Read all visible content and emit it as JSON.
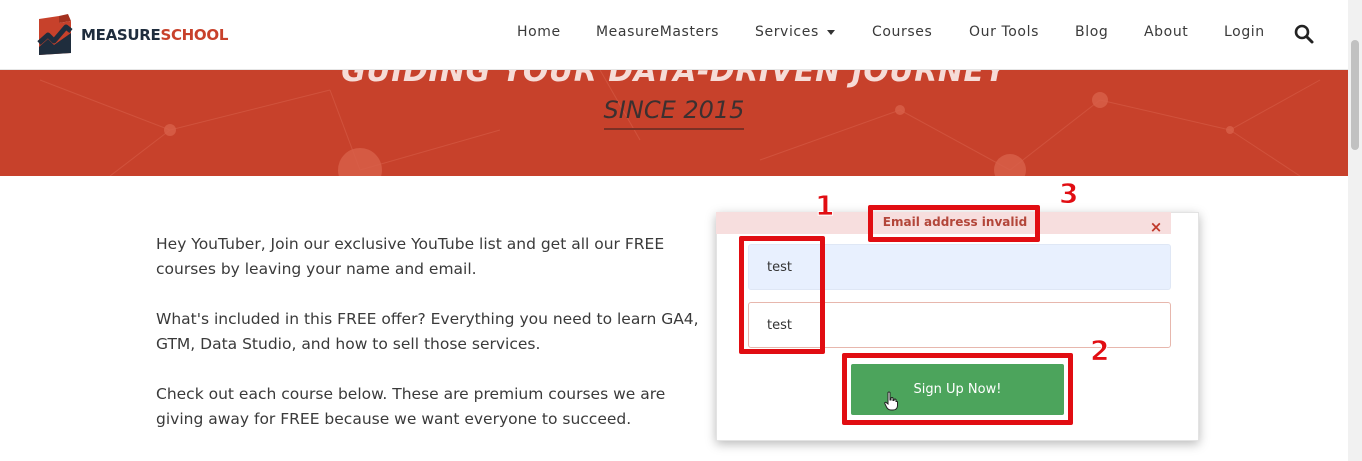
{
  "brand": {
    "name_part1": "MEASURE",
    "name_part2": "SCHOOL",
    "colors": {
      "primary": "#c7412b",
      "dark": "#1f2d3d",
      "success": "#4ca45c",
      "annotation": "#e10d12"
    }
  },
  "nav": {
    "items": [
      {
        "label": "Home"
      },
      {
        "label": "MeasureMasters"
      },
      {
        "label": "Services",
        "has_dropdown": true
      },
      {
        "label": "Courses"
      },
      {
        "label": "Our Tools"
      },
      {
        "label": "Blog"
      },
      {
        "label": "About"
      },
      {
        "label": "Login"
      }
    ],
    "search_icon": "search-icon"
  },
  "hero": {
    "title": "GUIDING YOUR DATA-DRIVEN JOURNEY",
    "subtitle": "SINCE 2015"
  },
  "intro": {
    "paragraphs": [
      "Hey YouTuber, Join our exclusive YouTube list and get all our FREE courses by leaving your name and email.",
      "What's included in this FREE offer? Everything you need to learn GA4, GTM, Data Studio, and how to sell those services.",
      "Check out each course below. These are premium courses we are giving away for FREE because we want everyone to succeed."
    ]
  },
  "form": {
    "error_message": "Email address invalid",
    "close_glyph": "×",
    "name_value": "test",
    "email_value": "test",
    "submit_label": "Sign Up Now!"
  },
  "annotations": {
    "labels": [
      "1",
      "2",
      "3"
    ]
  }
}
